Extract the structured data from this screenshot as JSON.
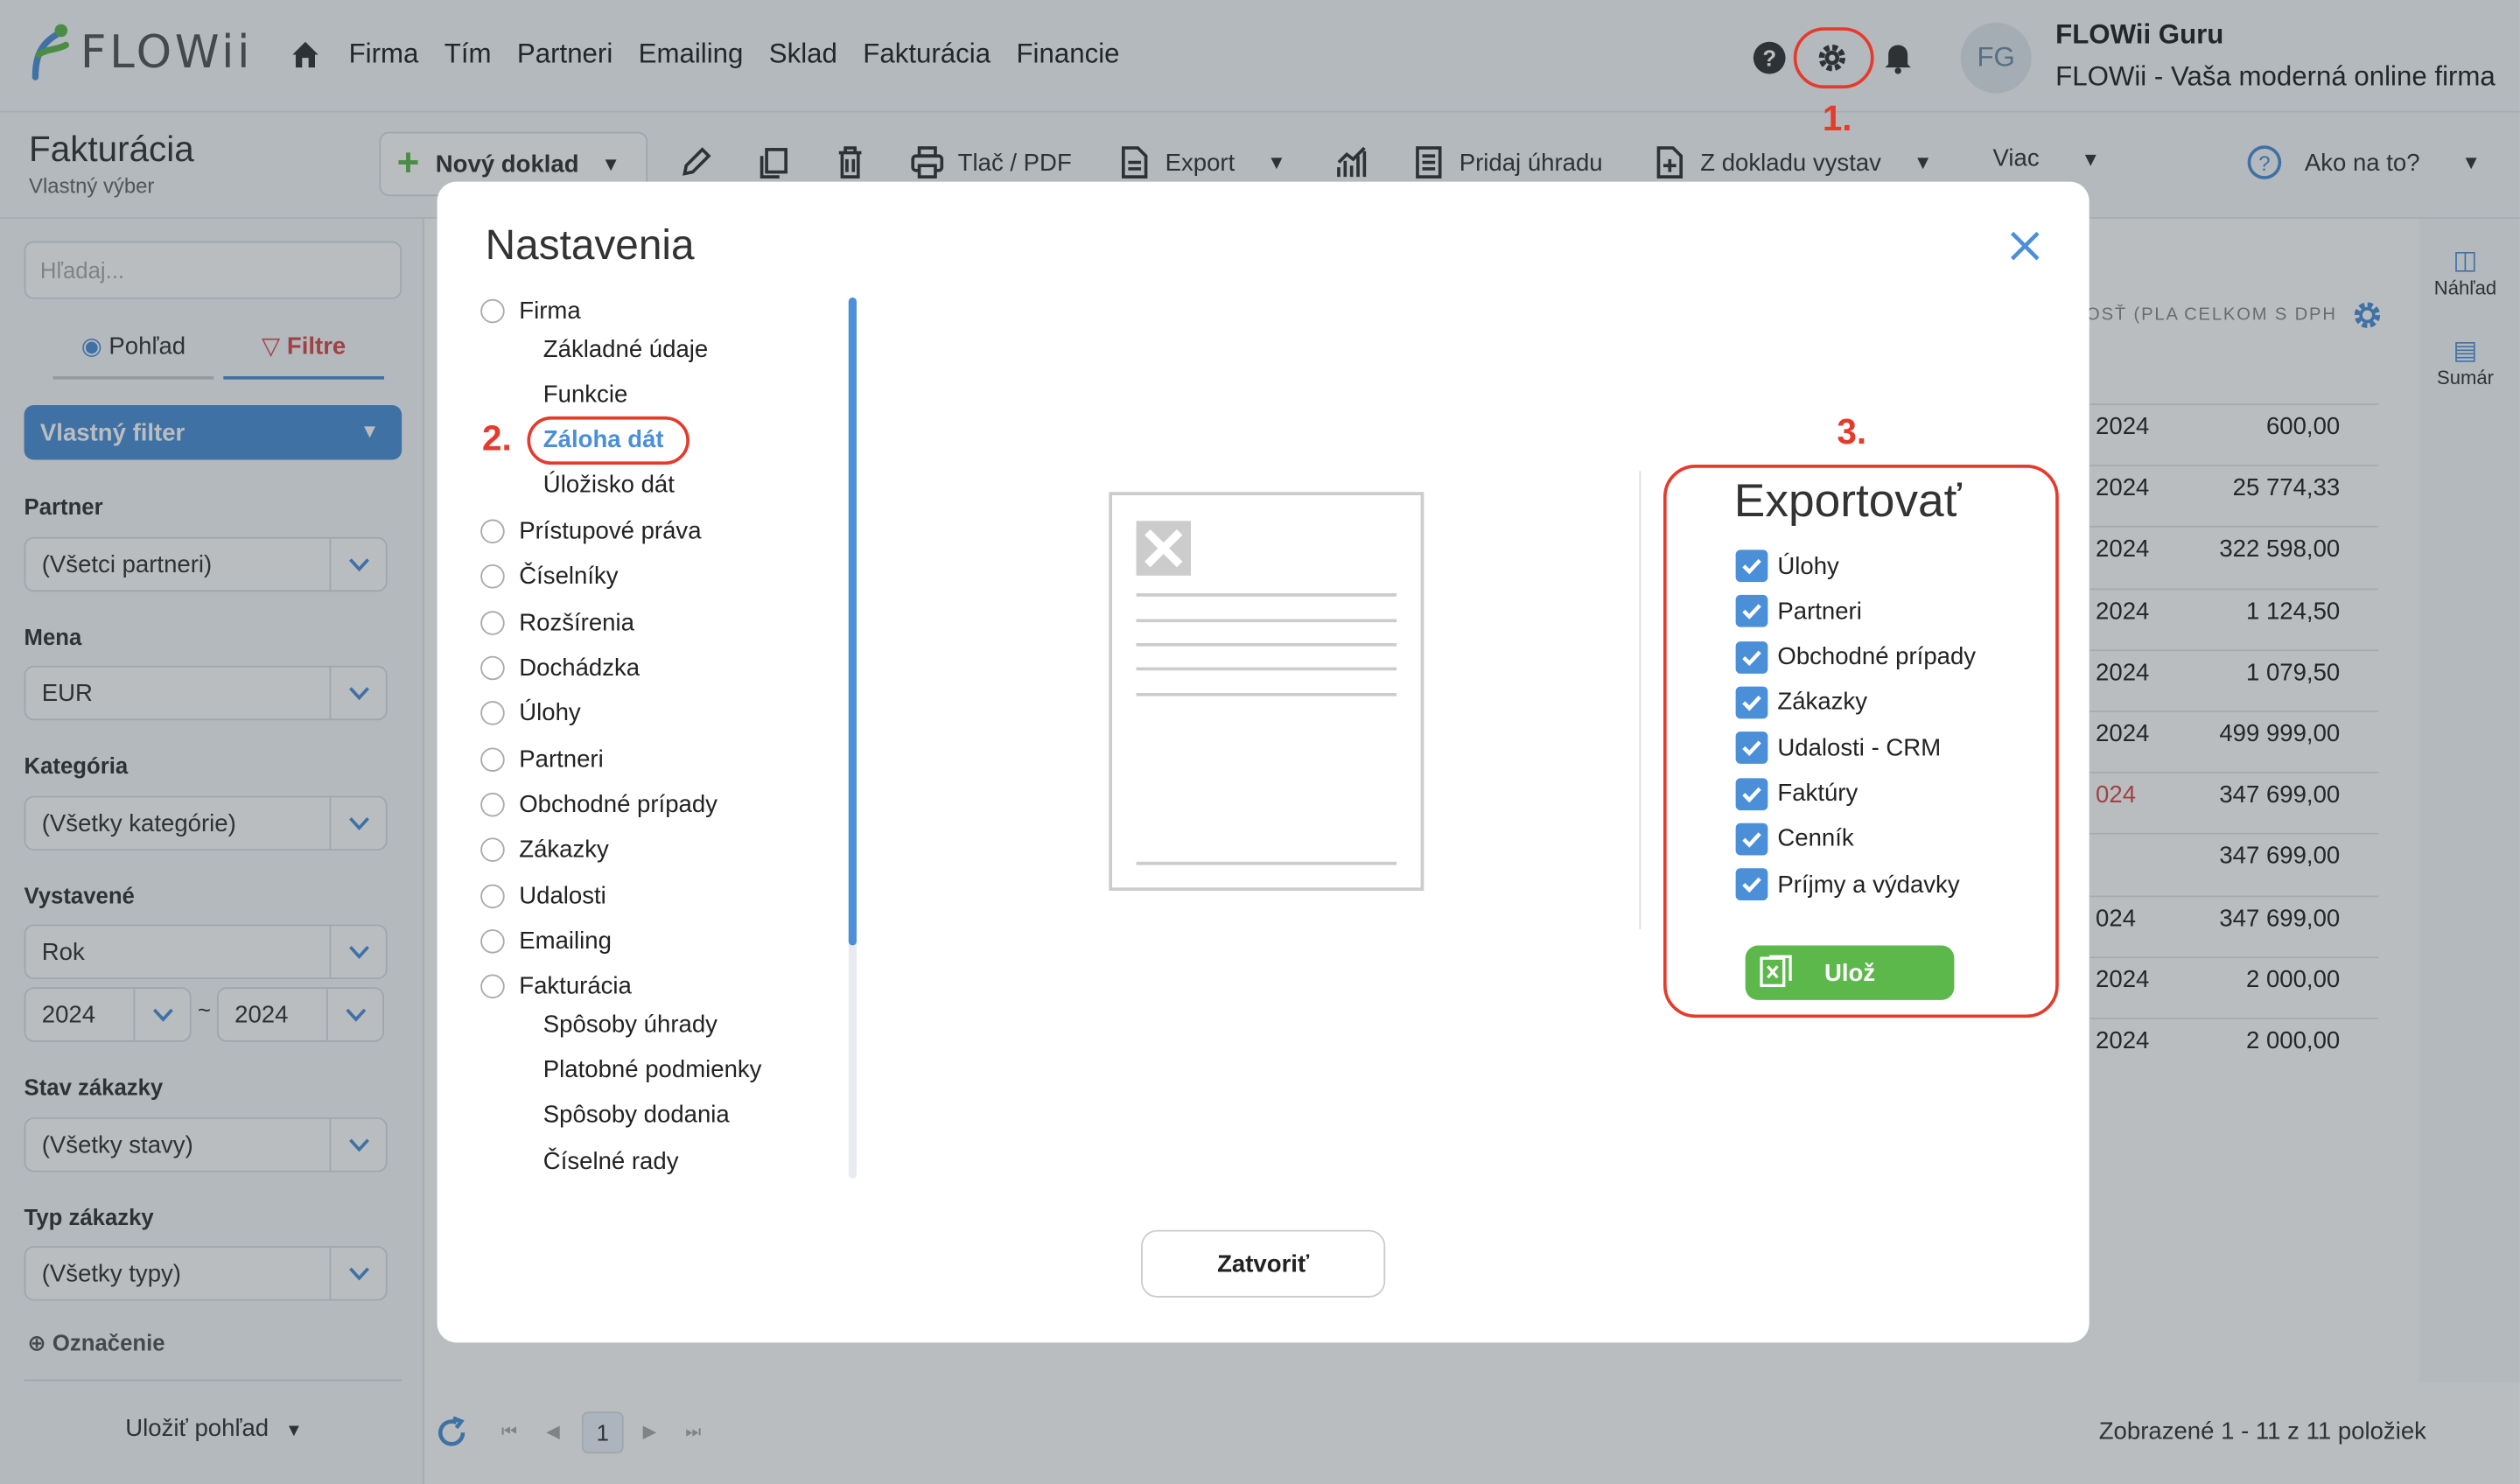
{
  "brand": {
    "name": "FLOWii"
  },
  "nav": {
    "links": [
      "Firma",
      "Tím",
      "Partneri",
      "Emailing",
      "Sklad",
      "Fakturácia",
      "Financie"
    ]
  },
  "user": {
    "initials": "FG",
    "name": "FLOWii Guru",
    "company": "FLOWii - Vaša moderná online firma"
  },
  "toolbar": {
    "page_title": "Fakturácia",
    "page_subtitle": "Vlastný výber",
    "new_doc": "Nový doklad",
    "print": "Tlač / PDF",
    "export": "Export",
    "add_payment": "Pridaj úhradu",
    "from_doc": "Z dokladu vystav",
    "more": "Viac",
    "help": "Ako na to?"
  },
  "left": {
    "search_placeholder": "Hľadaj...",
    "tab_view": "Pohľad",
    "tab_filters": "Filtre",
    "filter_name": "Vlastný filter",
    "partner_label": "Partner",
    "partner_value": "(Všetci partneri)",
    "currency_label": "Mena",
    "currency_value": "EUR",
    "category_label": "Kategória",
    "category_value": "(Všetky kategórie)",
    "issued_label": "Vystavené",
    "issued_value": "Rok",
    "year_from": "2024",
    "year_sep": "~",
    "year_to": "2024",
    "order_state_label": "Stav zákazky",
    "order_state_value": "(Všetky stavy)",
    "order_type_label": "Typ zákazky",
    "order_type_value": "(Všetky typy)",
    "marking": "Označenie",
    "save_view": "Uložiť pohľad"
  },
  "table": {
    "header_partial": "OSŤ (PLA",
    "header_total": "CELKOM S DPH",
    "rows": [
      {
        "date": "2024",
        "total": "600,00"
      },
      {
        "date": "2024",
        "total": "25 774,33"
      },
      {
        "date": "2024",
        "total": "322 598,00"
      },
      {
        "date": "2024",
        "total": "1 124,50"
      },
      {
        "date": "2024",
        "total": "1 079,50"
      },
      {
        "date": "2024",
        "total": "499 999,00"
      },
      {
        "date": "024",
        "total": "347 699,00"
      },
      {
        "date": "",
        "total": "347 699,00"
      },
      {
        "date": "024",
        "total": "347 699,00"
      },
      {
        "date": "2024",
        "total": "2 000,00"
      },
      {
        "date": "2024",
        "total": "2 000,00"
      }
    ]
  },
  "rightside": {
    "preview": "Náhľad",
    "summary": "Sumár"
  },
  "pager": {
    "page": "1",
    "info": "Zobrazené 1 - 11 z 11 položiek"
  },
  "modal": {
    "title": "Nastavenia",
    "tree": [
      {
        "label": "Firma",
        "expanded": true,
        "children": [
          "Základné údaje",
          "Funkcie",
          "Záloha dát",
          "Úložisko dát"
        ]
      },
      {
        "label": "Prístupové práva"
      },
      {
        "label": "Číselníky"
      },
      {
        "label": "Rozšírenia"
      },
      {
        "label": "Dochádzka"
      },
      {
        "label": "Úlohy"
      },
      {
        "label": "Partneri"
      },
      {
        "label": "Obchodné prípady"
      },
      {
        "label": "Zákazky"
      },
      {
        "label": "Udalosti"
      },
      {
        "label": "Emailing"
      },
      {
        "label": "Fakturácia",
        "expanded": true,
        "children": [
          "Spôsoby úhrady",
          "Platobné podmienky",
          "Spôsoby dodania",
          "Číselné rady"
        ]
      }
    ],
    "export_title": "Exportovať",
    "export_items": [
      "Úlohy",
      "Partneri",
      "Obchodné prípady",
      "Zákazky",
      "Udalosti - CRM",
      "Faktúry",
      "Cenník",
      "Príjmy a výdavky"
    ],
    "save_label": "Ulož",
    "close_label": "Zatvoriť"
  },
  "annotations": {
    "step1": "1.",
    "step2": "2.",
    "step3": "3."
  },
  "colors": {
    "accent": "#4a8fd8",
    "annotation": "#e53b2c",
    "save": "#5cb84a",
    "negative": "#d84a4a"
  }
}
